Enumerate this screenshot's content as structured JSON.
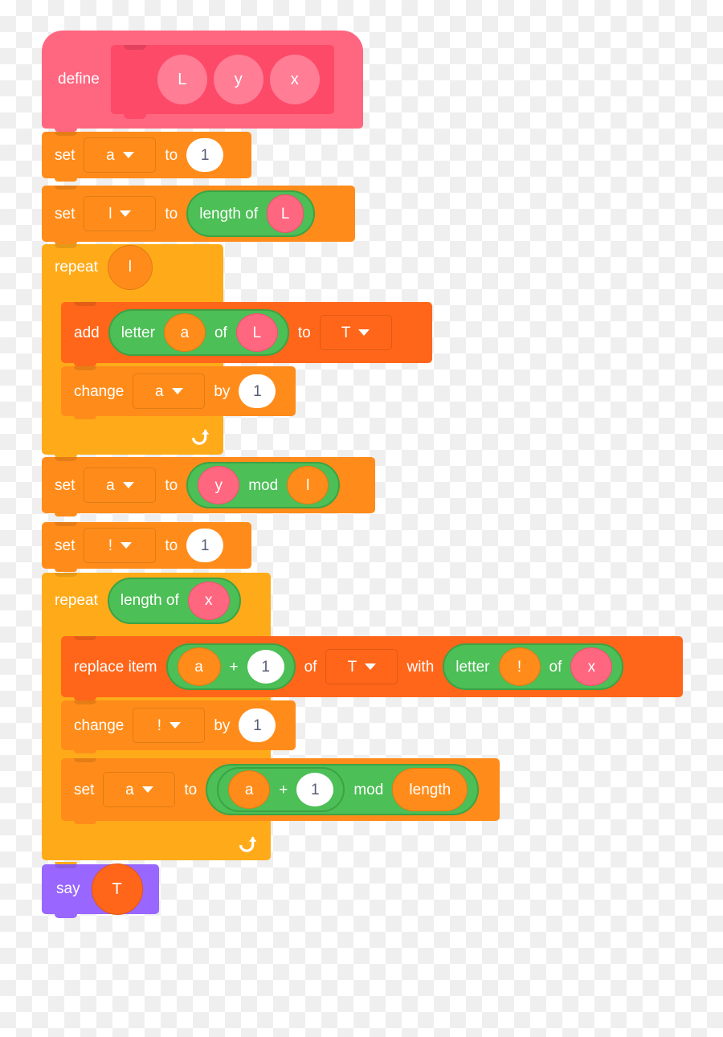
{
  "script": {
    "define": {
      "keyword": "define",
      "params": [
        "L",
        "y",
        "x"
      ]
    },
    "blocks": [
      {
        "id": "set-a-1",
        "type": "set",
        "keyword": "set",
        "variable": "a",
        "to_label": "to",
        "value": "1"
      },
      {
        "id": "set-l-length",
        "type": "set",
        "keyword": "set",
        "variable": "l",
        "to_label": "to",
        "operator": {
          "name": "length of",
          "argument": "L"
        }
      },
      {
        "id": "repeat-l",
        "type": "repeat",
        "keyword": "repeat",
        "times": "l",
        "children": [
          {
            "id": "add-letter",
            "type": "add-to-list",
            "keyword": "add",
            "to_label": "to",
            "list": "T",
            "operator": {
              "name": "letter",
              "of_label": "of",
              "index": "a",
              "string": "L"
            }
          },
          {
            "id": "change-a",
            "type": "change",
            "keyword": "change",
            "variable": "a",
            "by_label": "by",
            "value": "1"
          }
        ]
      },
      {
        "id": "set-a-mod",
        "type": "set",
        "keyword": "set",
        "variable": "a",
        "to_label": "to",
        "operator": {
          "left": "y",
          "name": "mod",
          "right": "l"
        }
      },
      {
        "id": "set-excl-1",
        "type": "set",
        "keyword": "set",
        "variable": "!",
        "to_label": "to",
        "value": "1"
      },
      {
        "id": "repeat-length-x",
        "type": "repeat",
        "keyword": "repeat",
        "operator": {
          "name": "length of",
          "argument": "x"
        },
        "children": [
          {
            "id": "replace-item",
            "type": "replace-item",
            "keyword": "replace item",
            "of_label": "of",
            "list": "T",
            "with_label": "with",
            "index_operator": {
              "left": "a",
              "name": "+",
              "right": "1"
            },
            "value_operator": {
              "name": "letter",
              "of_label": "of",
              "index": "!",
              "string": "x"
            }
          },
          {
            "id": "change-excl",
            "type": "change",
            "keyword": "change",
            "variable": "!",
            "by_label": "by",
            "value": "1"
          },
          {
            "id": "set-a-plus-mod",
            "type": "set",
            "keyword": "set",
            "variable": "a",
            "to_label": "to",
            "operator": {
              "name": "mod",
              "right": "length",
              "inner": {
                "left": "a",
                "name": "+",
                "right": "1"
              }
            }
          }
        ]
      },
      {
        "id": "say-t",
        "type": "say",
        "keyword": "say",
        "value": "T"
      }
    ]
  },
  "colors": {
    "data": "#ff8c1a",
    "list": "#ff661a",
    "control": "#ffab19",
    "operators": "#4cbf56",
    "looks": "#9966ff",
    "custom_define": "#ff6680",
    "custom_prototype": "#fc4a68",
    "input_white": "#ffffff",
    "input_text": "#575e75"
  }
}
